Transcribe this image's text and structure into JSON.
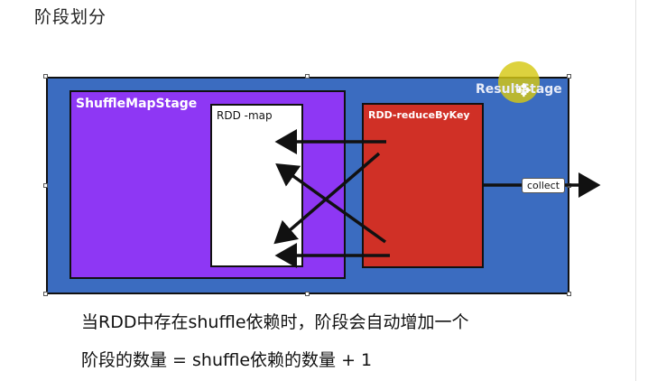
{
  "page": {
    "title": "阶段划分"
  },
  "diagram": {
    "result_stage_label": "ResultStage",
    "shuffle_map_stage_label": "ShuffleMapStage",
    "rdd_map_label": "RDD -map",
    "rdd_reduce_label": "RDD-reduceByKey",
    "collect_label": "collect",
    "colors": {
      "result_stage": "#3b6cc0",
      "shuffle_map_stage": "#8e37f4",
      "rdd_reduce": "#d03026",
      "rdd_map": "#ffffff"
    }
  },
  "captions": {
    "line1": "当RDD中存在shuffle依赖时，阶段会自动增加一个",
    "line2": "阶段的数量 = shuffle依赖的数量 + 1"
  }
}
